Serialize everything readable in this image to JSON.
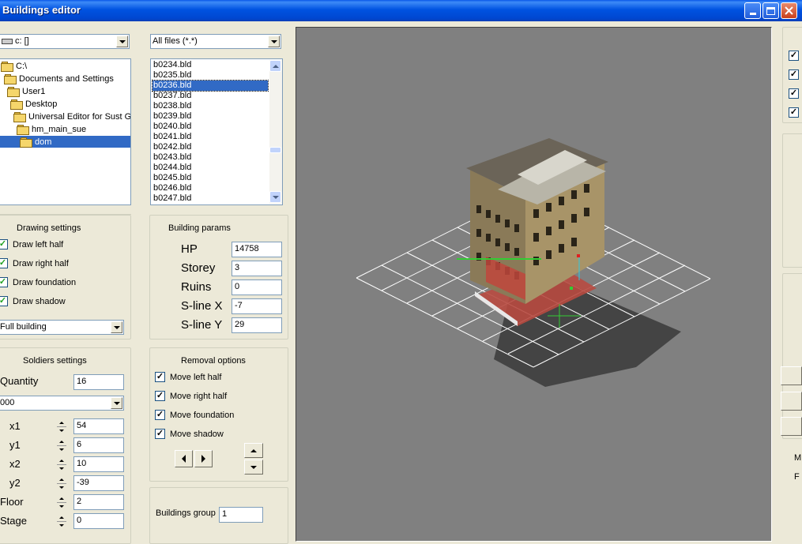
{
  "window": {
    "title": "Buildings editor"
  },
  "drive": {
    "value": "c: []"
  },
  "filter": {
    "value": "All files (*.*)"
  },
  "folders": [
    {
      "label": "C:\\",
      "selected": false
    },
    {
      "label": "Documents and Settings",
      "selected": false
    },
    {
      "label": "User1",
      "selected": false
    },
    {
      "label": "Desktop",
      "selected": false
    },
    {
      "label": "Universal Editor for Sust Gr",
      "selected": false
    },
    {
      "label": "hm_main_sue",
      "selected": false
    },
    {
      "label": "dom",
      "selected": true
    }
  ],
  "files": [
    "b0234.bld",
    "b0235.bld",
    "b0236.bld",
    "b0237.bld",
    "b0238.bld",
    "b0239.bld",
    "b0240.bld",
    "b0241.bld",
    "b0242.bld",
    "b0243.bld",
    "b0244.bld",
    "b0245.bld",
    "b0246.bld",
    "b0247.bld"
  ],
  "selected_file": "b0236.bld",
  "drawing": {
    "title": "Drawing settings",
    "options": [
      {
        "label": "Draw left half",
        "checked": true
      },
      {
        "label": "Draw right half",
        "checked": true
      },
      {
        "label": "Draw foundation",
        "checked": true
      },
      {
        "label": "Draw shadow",
        "checked": true
      }
    ],
    "mode": "Full building"
  },
  "params": {
    "title": "Building params",
    "fields": [
      {
        "label": "HP",
        "value": "14758"
      },
      {
        "label": "Storey",
        "value": "3"
      },
      {
        "label": "Ruins",
        "value": "0"
      },
      {
        "label": "S-line X",
        "value": "-7"
      },
      {
        "label": "S-line Y",
        "value": "29"
      }
    ]
  },
  "soldiers": {
    "title": "Soldiers settings",
    "quantity_label": "Quantity",
    "quantity": "16",
    "slot": "000",
    "fields": [
      {
        "label": "x1",
        "value": "54"
      },
      {
        "label": "y1",
        "value": "6"
      },
      {
        "label": "x2",
        "value": "10"
      },
      {
        "label": "y2",
        "value": "-39"
      },
      {
        "label": "Floor",
        "value": "2"
      },
      {
        "label": "Stage",
        "value": "0"
      }
    ]
  },
  "removal": {
    "title": "Removal options",
    "options": [
      {
        "label": "Move left half",
        "checked": true
      },
      {
        "label": "Move right half",
        "checked": true
      },
      {
        "label": "Move foundation",
        "checked": true
      },
      {
        "label": "Move shadow",
        "checked": true
      }
    ]
  },
  "group": {
    "label": "Buildings group",
    "value": "1"
  },
  "right_panel": {
    "checkbox_count": 4,
    "letters": [
      "M",
      "F"
    ]
  },
  "colors": {
    "titlebar": "#0053E1",
    "selection": "#316AC5",
    "viewport": "#808080",
    "grid": "#FFFFFF"
  }
}
